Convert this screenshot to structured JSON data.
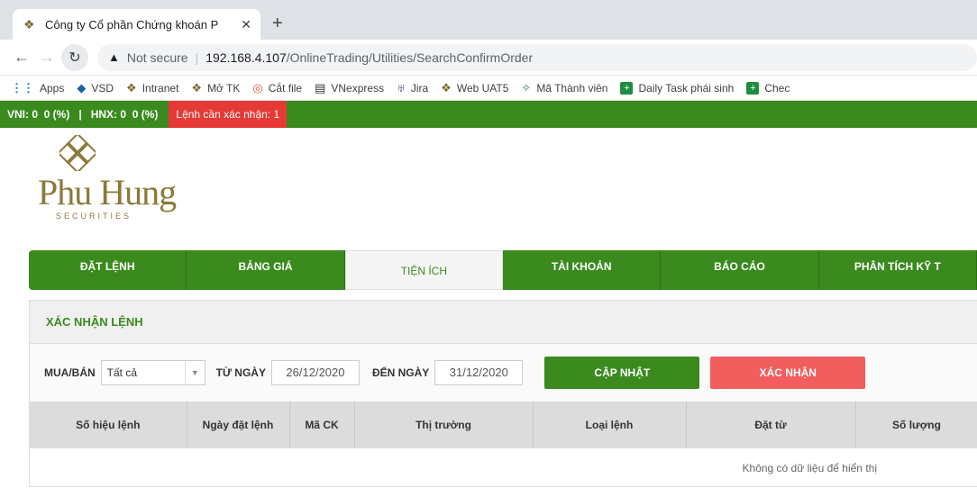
{
  "browser": {
    "tab_title": "Công ty Cổ phần Chứng khoán P",
    "tab_close": "✕",
    "new_tab": "+",
    "address": {
      "security": "Not secure",
      "host": "192.168.4.107",
      "path": "/OnlineTrading/Utilities/SearchConfirmOrder"
    },
    "bookmarks": [
      {
        "label": "Apps",
        "icon": "apps-grid-icon"
      },
      {
        "label": "VSD",
        "icon": "vsd-icon"
      },
      {
        "label": "Intranet",
        "icon": "phu-hung-icon"
      },
      {
        "label": "Mở TK",
        "icon": "phu-hung-icon"
      },
      {
        "label": "Cắt file",
        "icon": "swirl-icon"
      },
      {
        "label": "VNexpress",
        "icon": "news-icon"
      },
      {
        "label": "Jira",
        "icon": "jira-icon"
      },
      {
        "label": "Web UAT5",
        "icon": "phu-hung-icon"
      },
      {
        "label": "Mã Thành viên",
        "icon": "diamond-icon"
      },
      {
        "label": "Daily Task phái sinh",
        "icon": "sheet-icon"
      },
      {
        "label": "Chec",
        "icon": "sheet-icon"
      }
    ]
  },
  "ticker": {
    "indices": "VNI: 0  0 (%)   |   HNX: 0  0 (%)",
    "pending": "Lệnh cần xác nhận: 1"
  },
  "logo": {
    "brand": "Phu Hung",
    "sub": "SECURITIES"
  },
  "nav": [
    {
      "label": "ĐẶT LỆNH"
    },
    {
      "label": "BẢNG GIÁ"
    },
    {
      "label": "TIỆN ÍCH"
    },
    {
      "label": "TÀI KHOẢN"
    },
    {
      "label": "BÁO CÁO"
    },
    {
      "label": "PHÂN TÍCH KỸ T"
    }
  ],
  "panel": {
    "title": "XÁC NHẬN LỆNH",
    "filters": {
      "side_label": "MUA/BÁN",
      "side_value": "Tất cả",
      "from_label": "TỪ NGÀY",
      "from_value": "26/12/2020",
      "to_label": "ĐẾN NGÀY",
      "to_value": "31/12/2020",
      "update_button": "CẬP NHẬT",
      "confirm_button": "XÁC NHẬN"
    },
    "columns": [
      "Số hiệu lệnh",
      "Ngày đặt lệnh",
      "Mã CK",
      "Thị trường",
      "Loại lệnh",
      "Đặt từ",
      "Số lượng"
    ],
    "empty_text": "Không có dữ liệu để hiển thị"
  },
  "colors": {
    "brand_green": "#3a8a1e",
    "alert_red": "#e53935",
    "confirm_red": "#f25d5d",
    "logo_gold": "#8a7a3a"
  }
}
